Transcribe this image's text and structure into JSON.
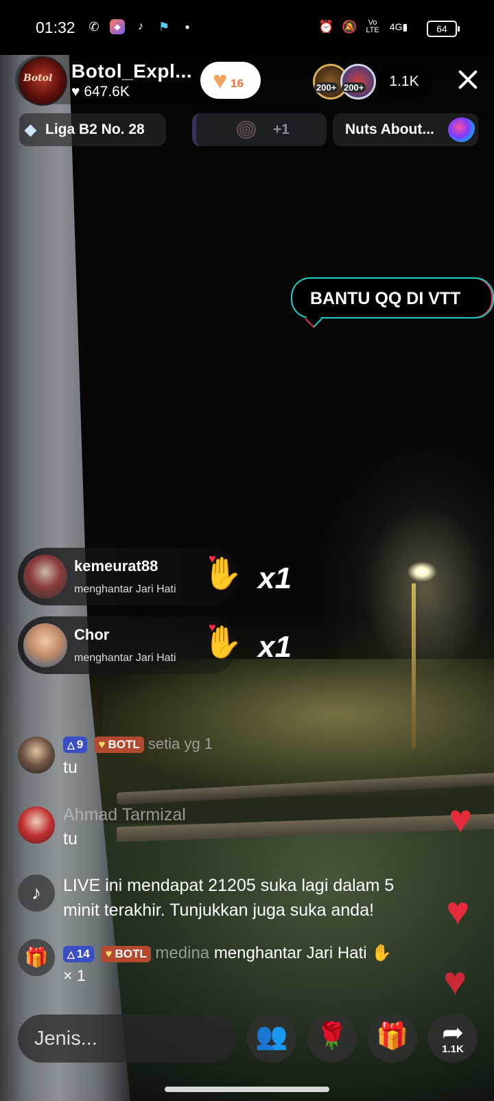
{
  "status_bar": {
    "time": "01:32",
    "battery": "64",
    "signal": "4G"
  },
  "host": {
    "name": "Botol_Expl...",
    "likes": "647.6K",
    "avatar_text": "Botol",
    "follow_count": "16"
  },
  "viewers": {
    "badge_1": "200+",
    "badge_2": "200+",
    "count": "1.1K"
  },
  "chips": {
    "league": "Liga B2 No. 28",
    "extra": "+1",
    "ranking": "Nuts About..."
  },
  "pinned_bubble": "BANTU QQ DI VTT",
  "gifts": [
    {
      "user": "kemeurat88",
      "action": "menghantar Jari Hati",
      "count": "x1"
    },
    {
      "user": "Chor",
      "action": "menghantar Jari Hati",
      "count": "x1"
    }
  ],
  "comments": [
    {
      "level": "9",
      "fan_badge": "BOTL",
      "username": "setia yg 1",
      "text": "tu"
    },
    {
      "username": "Ahmad Tarmizal",
      "text": "tu"
    },
    {
      "text_line1": "LIVE ini mendapat 21205 suka lagi dalam 5",
      "text_line2": "minit terakhir. Tunjukkan juga suka anda!"
    },
    {
      "level": "14",
      "fan_badge": "BOTL",
      "username": "medina",
      "action": "menghantar Jari Hati",
      "count": "× 1"
    }
  ],
  "input": {
    "placeholder": "Jenis..."
  },
  "share": {
    "count": "1.1K"
  },
  "colors": {
    "accent_red": "#e52a3a",
    "bubble_border": "#1bd1c8",
    "level_badge": "#3b4fc4",
    "fan_badge": "#b34a2f"
  }
}
